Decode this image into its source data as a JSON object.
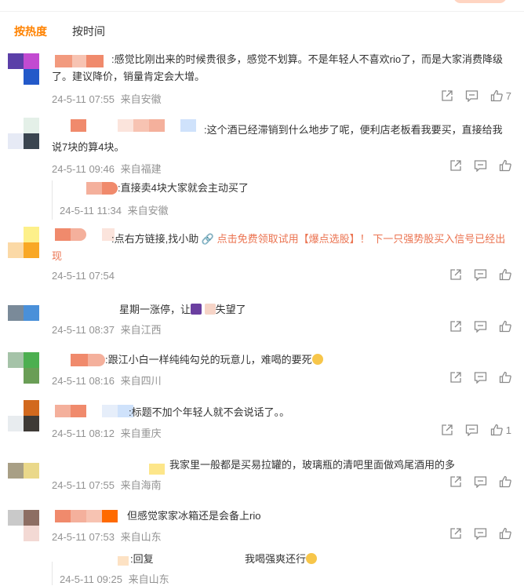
{
  "tabs": [
    {
      "label": "按热度"
    },
    {
      "label": "按时间"
    }
  ],
  "comments": [
    {
      "text": ":感觉比刚出来的时候贵很多，感觉不划算。不是年轻人不喜欢rio了，而是大家消费降级了。建议降价，销量肯定会大增。",
      "time": "24-5-11 07:55",
      "location": "来自安徽",
      "likes": "7"
    },
    {
      "text": ":这个酒已经滞销到什么地步了呢，便利店老板看我要买，直接给我说7块的算4块。",
      "time": "24-5-11 09:46",
      "location": "来自福建",
      "likes": "",
      "reply": {
        "text": ":直接卖4块大家就会主动买了",
        "time": "24-5-11 11:34",
        "location": "来自安徽"
      }
    },
    {
      "text_prefix": ":点右方链接,找小助",
      "link_text": "点击免费领取试用【爆点选股】！ 下一只强势股买入信号已经出现",
      "time": "24-5-11 07:54",
      "location": "",
      "likes": ""
    },
    {
      "text_prefix": "星期一涨停，让",
      "text_suffix": "失望了",
      "time": "24-5-11 08:37",
      "location": "来自江西",
      "likes": ""
    },
    {
      "text": ":跟江小白一样纯纯勾兑的玩意儿，难喝的要死",
      "time": "24-5-11 08:16",
      "location": "来自四川",
      "likes": ""
    },
    {
      "text": ":标题不加个年轻人就不会说话了。。",
      "time": "24-5-11 08:12",
      "location": "来自重庆",
      "likes": "1"
    },
    {
      "text": "我家里一般都是买易拉罐的，玻璃瓶的清吧里面做鸡尾酒用的多",
      "time": "24-5-11 07:55",
      "location": "来自海南",
      "likes": ""
    },
    {
      "text": "但感觉家家冰箱还是会备上rio",
      "time": "24-5-11 07:53",
      "location": "来自山东",
      "likes": "",
      "reply": {
        "text_prefix": ":回复",
        "text": "我喝强爽还行",
        "time": "24-5-11 09:25",
        "location": "来自山东"
      }
    }
  ],
  "colors": {
    "accent": "#ff8200",
    "meta": "#939393",
    "link": "#eb7350"
  }
}
